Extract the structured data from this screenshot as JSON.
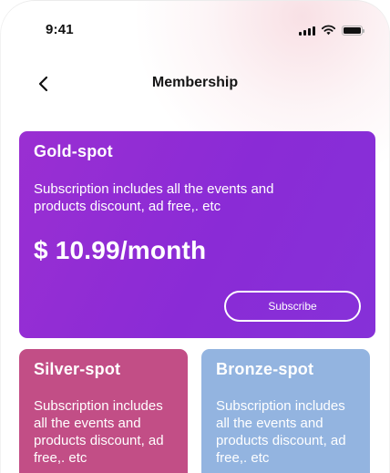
{
  "status_bar": {
    "time": "9:41",
    "icons": [
      "signal-icon",
      "wifi-icon",
      "battery-icon"
    ]
  },
  "header": {
    "title": "Membership",
    "back_icon": "chevron-left-icon"
  },
  "plans": {
    "gold": {
      "name": "Gold-spot",
      "description": "Subscription includes all the events and products discount, ad free,. etc",
      "price": "$ 10.99/month",
      "subscribe_label": "Subscribe",
      "color": "#8a2bd6"
    },
    "silver": {
      "name": "Silver-spot",
      "description": "Subscription includes all the events and products discount, ad free,. etc",
      "color": "#c24e86"
    },
    "bronze": {
      "name": "Bronze-spot",
      "description": "Subscription includes all the events and products discount, ad free,. etc",
      "color": "#93b4e0"
    }
  }
}
